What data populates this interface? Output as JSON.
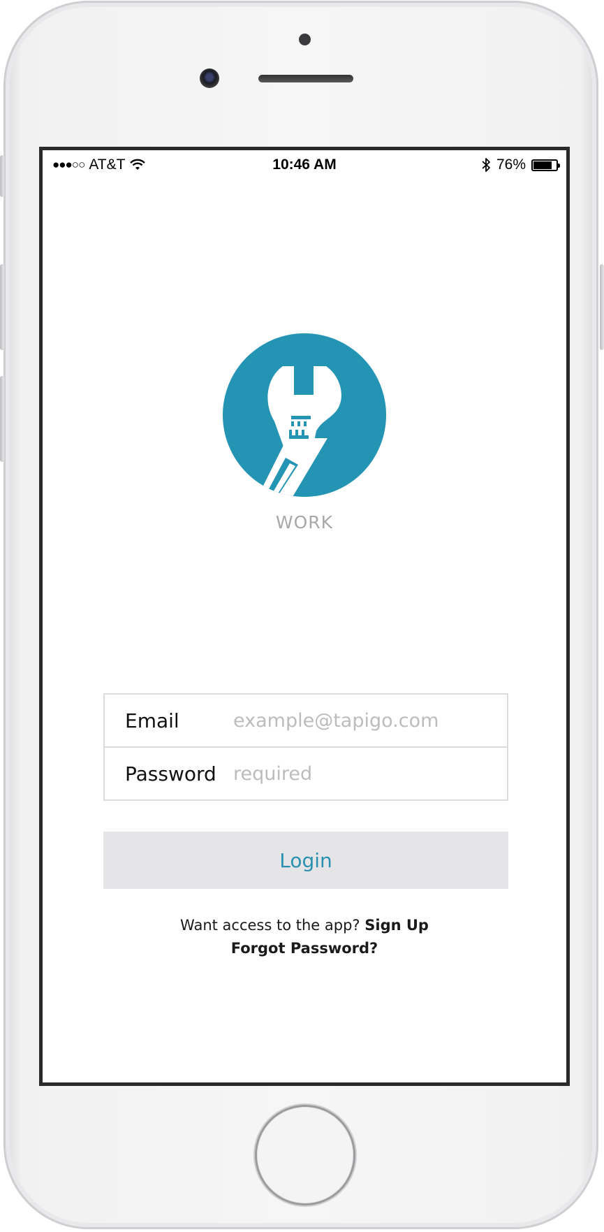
{
  "status_bar": {
    "signal": "●●●○○",
    "carrier": "AT&T",
    "time": "10:46 AM",
    "battery_percent": "76%",
    "battery_level": 0.76
  },
  "app": {
    "name": "WORK",
    "logo_icon": "wrench-icon",
    "brand_color": "#2494b4"
  },
  "login_form": {
    "email_label": "Email",
    "email_placeholder": "example@tapigo.com",
    "email_value": "",
    "password_label": "Password",
    "password_placeholder": "required",
    "password_value": ""
  },
  "login_button_label": "Login",
  "signup_prompt": "Want access to the app?",
  "signup_link": "Sign Up",
  "forgot_password_link": "Forgot Password?",
  "colors": {
    "accent": "#2a90b2",
    "button_bg": "#e5e5e7",
    "placeholder": "#bcbcbc"
  }
}
